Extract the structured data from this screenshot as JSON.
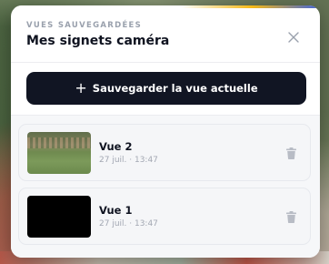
{
  "panel": {
    "eyebrow": "VUES SAUVEGARDÉES",
    "title": "Mes signets caméra",
    "close_icon": "close-icon"
  },
  "save_button": {
    "icon": "plus-icon",
    "label": "Sauvegarder la vue actuelle"
  },
  "bookmarks": [
    {
      "title": "Vue 2",
      "date": "27 juil. · 13:47",
      "thumbnail": "aerial landscape",
      "delete_icon": "trash-icon"
    },
    {
      "title": "Vue 1",
      "date": "27 juil. · 13:47",
      "thumbnail": "black",
      "delete_icon": "trash-icon"
    }
  ],
  "colors": {
    "primary_button": "#111523",
    "accent_yellow": "#f5b915",
    "accent_blue": "#3e63dd",
    "muted_text": "#a3a8b3"
  }
}
